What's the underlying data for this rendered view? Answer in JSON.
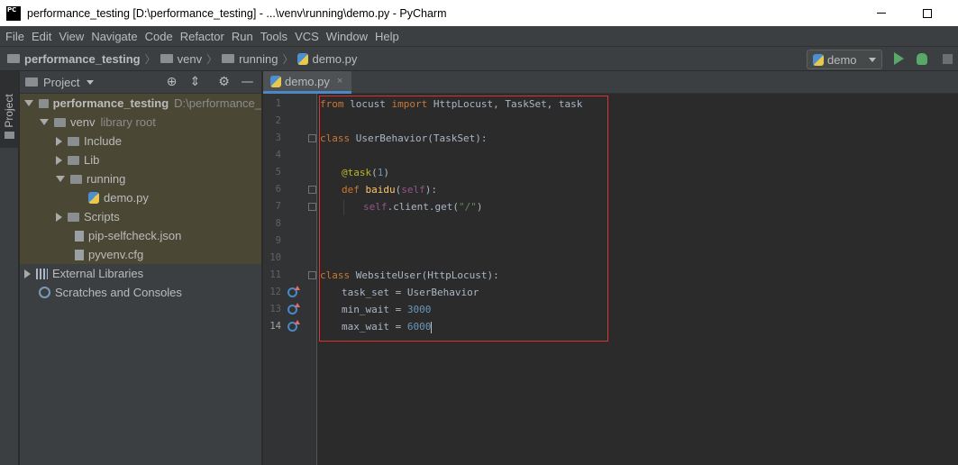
{
  "window": {
    "title": "performance_testing [D:\\performance_testing] - ...\\venv\\running\\demo.py - PyCharm",
    "logo_text": "PC"
  },
  "menu": [
    "File",
    "Edit",
    "View",
    "Navigate",
    "Code",
    "Refactor",
    "Run",
    "Tools",
    "VCS",
    "Window",
    "Help"
  ],
  "breadcrumb": [
    "performance_testing",
    "venv",
    "running",
    "demo.py"
  ],
  "run_config": {
    "name": "demo"
  },
  "tool_strip": {
    "label": "1: Project"
  },
  "project_panel": {
    "title": "Project",
    "tree": [
      {
        "label": "performance_testing",
        "extra": "D:\\performance_",
        "icon": "folder-icon",
        "expanded": true,
        "level": 0
      },
      {
        "label": "venv",
        "extra": "library root",
        "icon": "folder-icon",
        "expanded": true,
        "level": 1
      },
      {
        "label": "Include",
        "extra": "",
        "icon": "folder-icon",
        "expanded": false,
        "level": 2
      },
      {
        "label": "Lib",
        "extra": "",
        "icon": "folder-icon",
        "expanded": false,
        "level": 2
      },
      {
        "label": "running",
        "extra": "",
        "icon": "folder-icon",
        "expanded": true,
        "level": 2
      },
      {
        "label": "demo.py",
        "extra": "",
        "icon": "python-file-icon",
        "level": 3
      },
      {
        "label": "Scripts",
        "extra": "",
        "icon": "folder-icon",
        "expanded": false,
        "level": 2
      },
      {
        "label": "pip-selfcheck.json",
        "extra": "",
        "icon": "file-icon",
        "level": 2
      },
      {
        "label": "pyvenv.cfg",
        "extra": "",
        "icon": "file-icon",
        "level": 2
      },
      {
        "label": "External Libraries",
        "extra": "",
        "icon": "library-icon",
        "expanded": false,
        "level": 0
      },
      {
        "label": "Scratches and Consoles",
        "extra": "",
        "icon": "scratch-icon",
        "level": 0
      }
    ]
  },
  "editor": {
    "tab": "demo.py",
    "tab_close": "×",
    "line_numbers": [
      "1",
      "2",
      "3",
      "4",
      "5",
      "6",
      "7",
      "8",
      "9",
      "10",
      "11",
      "12",
      "13",
      "14"
    ],
    "code": {
      "l1_from": "from",
      "l1_mod": " locust ",
      "l1_import": "import",
      "l1_rest": " HttpLocust, TaskSet, task",
      "l3_class": "class",
      "l3_rest": " UserBehavior(TaskSet):",
      "l5_dec": "@task",
      "l5_open": "(",
      "l5_num": "1",
      "l5_close": ")",
      "l6_def": "def",
      "l6_fn": " baidu",
      "l6_open": "(",
      "l6_self": "self",
      "l6_close": "):",
      "l7_self": "self",
      "l7_mid": ".client.get(",
      "l7_str": "\"/\"",
      "l7_close": ")",
      "l11_class": "class",
      "l11_rest": " WebsiteUser(HttpLocust):",
      "l12_text": "task_set = UserBehavior",
      "l13_text": "min_wait = ",
      "l13_num": "3000",
      "l14_text": "max_wait = ",
      "l14_num": "6000"
    }
  },
  "colors": {
    "keyword": "#cc7832",
    "function": "#ffc66d",
    "decorator": "#bbb529",
    "number": "#6897bb",
    "string": "#6a8759",
    "self": "#94558d",
    "highlight_box": "#e03030",
    "run": "#59a869"
  }
}
